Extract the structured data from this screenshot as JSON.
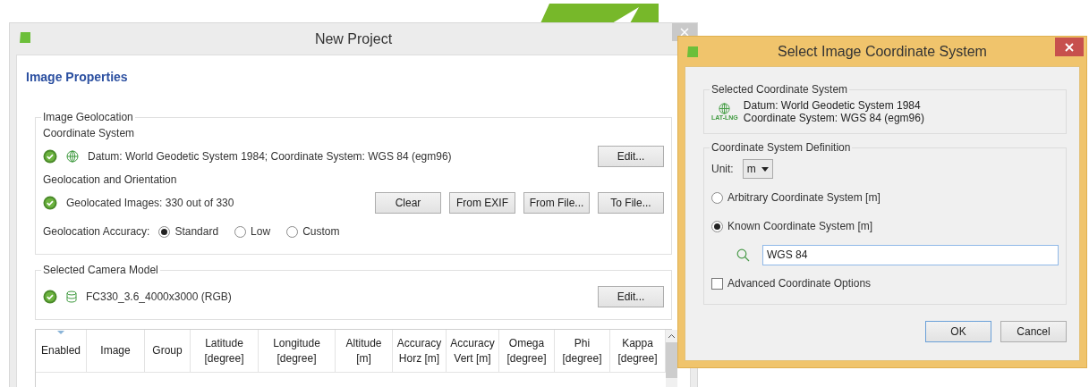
{
  "main_window": {
    "title": "New Project",
    "heading": "Image Properties",
    "geolocation": {
      "legend": "Image Geolocation",
      "coordinate_label": "Coordinate System",
      "coordinate_text": "Datum: World Geodetic System 1984; Coordinate System: WGS 84 (egm96)",
      "edit_button": "Edit...",
      "orientation_label": "Geolocation and Orientation",
      "geolocated_text": "Geolocated Images: 330 out of 330",
      "buttons": [
        "Clear",
        "From EXIF",
        "From File...",
        "To File..."
      ],
      "accuracy_label": "Geolocation Accuracy:",
      "accuracy_options": [
        {
          "label": "Standard",
          "selected": true
        },
        {
          "label": "Low",
          "selected": false
        },
        {
          "label": "Custom",
          "selected": false
        }
      ]
    },
    "camera": {
      "legend": "Selected Camera Model",
      "model": "FC330_3.6_4000x3000 (RGB)",
      "edit_button": "Edit..."
    },
    "table": {
      "columns": [
        {
          "lines": [
            "Enabled"
          ],
          "sorted": true
        },
        {
          "lines": [
            "Image"
          ],
          "sorted": false
        },
        {
          "lines": [
            "Group"
          ],
          "sorted": false
        },
        {
          "lines": [
            "Latitude",
            "[degree]"
          ],
          "sorted": false
        },
        {
          "lines": [
            "Longitude",
            "[degree]"
          ],
          "sorted": false
        },
        {
          "lines": [
            "Altitude",
            "[m]"
          ],
          "sorted": false
        },
        {
          "lines": [
            "Accuracy",
            "Horz [m]"
          ],
          "sorted": false
        },
        {
          "lines": [
            "Accuracy",
            "Vert [m]"
          ],
          "sorted": false
        },
        {
          "lines": [
            "Omega",
            "[degree]"
          ],
          "sorted": false
        },
        {
          "lines": [
            "Phi",
            "[degree]"
          ],
          "sorted": false
        },
        {
          "lines": [
            "Kappa",
            "[degree]"
          ],
          "sorted": false
        }
      ]
    }
  },
  "dialog": {
    "title": "Select Image Coordinate System",
    "selected_group": {
      "legend": "Selected Coordinate System",
      "icon_label": "LAT-LNG",
      "datum": "Datum: World Geodetic System 1984",
      "system": "Coordinate System: WGS 84 (egm96)"
    },
    "definition": {
      "legend": "Coordinate System Definition",
      "unit_label": "Unit:",
      "unit_value": "m",
      "options": [
        {
          "label": "Arbitrary Coordinate System [m]",
          "selected": false
        },
        {
          "label": "Known Coordinate System [m]",
          "selected": true
        }
      ],
      "search_value": "WGS 84",
      "advanced": {
        "label": "Advanced Coordinate Options",
        "checked": false
      }
    },
    "buttons": [
      {
        "label": "OK",
        "default": true
      },
      {
        "label": "Cancel",
        "default": false
      }
    ]
  }
}
